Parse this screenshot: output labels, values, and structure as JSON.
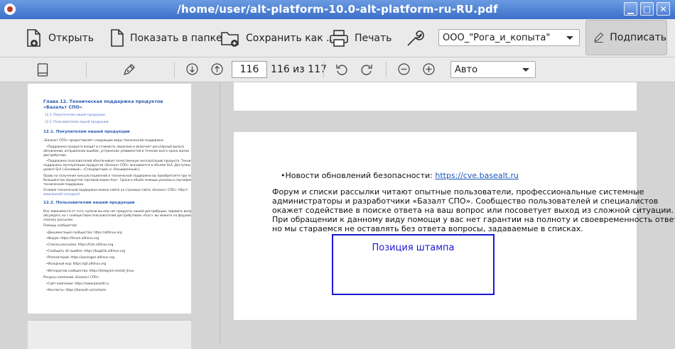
{
  "window": {
    "title": "/home/user/alt-platform-10.0-alt-platform-ru-RU.pdf",
    "buttons": [
      "minimize",
      "maximize",
      "close"
    ]
  },
  "toolbar": {
    "open_label": "Открыть",
    "show_in_folder_label": "Показать в папке",
    "save_as_label": "Сохранить как ...",
    "print_label": "Печать",
    "organization_value": "ООО_\"Рога_и_копыта\"",
    "sign_label": "Подписать"
  },
  "nav": {
    "page_value": "116",
    "page_total": "116 из 117",
    "zoom_value": "Авто"
  },
  "thumbnail": {
    "lines": [
      {
        "text": "Глава 12. Техническая поддержка продуктов «Базальт СПО»",
        "cls": "h1"
      },
      {
        "text": "12.1. Покупателям нашей продукции",
        "cls": "lnk"
      },
      {
        "text": "12.2. Пользователям нашей продукции",
        "cls": "lnk"
      },
      {
        "text": "12.1. Покупателям нашей продукции",
        "cls": "h2"
      },
      {
        "text": "«Базальт СПО» предоставляет следующие виды технической поддержки:",
        "cls": ""
      },
      {
        "text": "•Поддержка продукта входит в стоимость лицензии и включает регулярный выпуск",
        "cls": ""
      },
      {
        "text": "обновлений, исправление ошибок, устранение уязвимостей в течение всего срока жизни",
        "cls": ""
      },
      {
        "text": "дистрибутива.",
        "cls": ""
      },
      {
        "text": "•Поддержка пользователей обеспечивает качественную эксплуатацию продукта. Техническая",
        "cls": ""
      },
      {
        "text": "поддержка эксплуатации продуктов «Базальт СПО» оказывается в объеме SLA. Доступны три",
        "cls": ""
      },
      {
        "text": "уровня SLA («Базовый», «Стандартный» и «Расширенный»).",
        "cls": ""
      },
      {
        "text": "Право на получение консультационной и технической поддержки вы приобретаете при покупке",
        "cls": ""
      },
      {
        "text": "большинства продуктов торговой марки Альт. Сроки и объём помощи указаны в сертификате",
        "cls": ""
      },
      {
        "text": "технической поддержки.",
        "cls": ""
      },
      {
        "text": "Условия технической поддержки можно найти на странице сайта «Базальт СПО»: http://",
        "cls": ""
      },
      {
        "text": "www.basealt.ru/support.",
        "cls": "lnk"
      },
      {
        "text": "12.2. Пользователям нашей продукции",
        "cls": "h2"
      },
      {
        "text": "Вне зависимости от того, купили вы или нет продукты нашей дистрибуции, задавать вопросы или",
        "cls": ""
      },
      {
        "text": "обсуждать их с сообществом пользователей дистрибутивов «Альт» вы можете на форумах или в",
        "cls": ""
      },
      {
        "text": "списках рассылки.",
        "cls": ""
      },
      {
        "text": "Помощь сообщества:",
        "cls": ""
      },
      {
        "text": "•Документация сообщества: https://altlinux.org",
        "cls": ""
      },
      {
        "text": "•Форум: https://forum.altlinux.org",
        "cls": ""
      },
      {
        "text": "•Списки рассылки: https://lists.altlinux.org",
        "cls": ""
      },
      {
        "text": "•Сообщить об ошибке: https://bugzilla.altlinux.org",
        "cls": ""
      },
      {
        "text": "•Репозиторий: https://packages.altlinux.org",
        "cls": ""
      },
      {
        "text": "•Исходный код: https://git.altlinux.org",
        "cls": ""
      },
      {
        "text": "•Интерактив сообщества: https://telegram.me/alt_linux",
        "cls": ""
      },
      {
        "text": "Ресурсы компании «Базальт СПО»:",
        "cls": ""
      },
      {
        "text": "•Сайт компании: https://www.basealt.ru",
        "cls": ""
      },
      {
        "text": "•Контакты: https://basealt.ru/contacts",
        "cls": ""
      }
    ]
  },
  "page": {
    "bullet_text": "•Новости обновлений безопасности: ",
    "bullet_link": "https://cve.basealt.ru",
    "paragraph": [
      "Форум и списки рассылки читают опытные пользователи, профессиональные системные",
      "администраторы и разработчики «Базалт СПО». Сообщество пользователей и специалистов",
      "окажет содействие в поиске ответа на ваш вопрос или посоветует выход из сложной ситуации.",
      "При обращении к данному виду помощи у вас нет гарантии на полноту и своевременность ответа,",
      "но мы стараемся не оставлять без ответа вопросы, задаваемые в списках."
    ],
    "stamp_label": "Позиция штампа"
  },
  "colors": {
    "titlebar": "#4b7fd4",
    "stamp": "#1a1ad2",
    "link": "#1d57b8"
  }
}
